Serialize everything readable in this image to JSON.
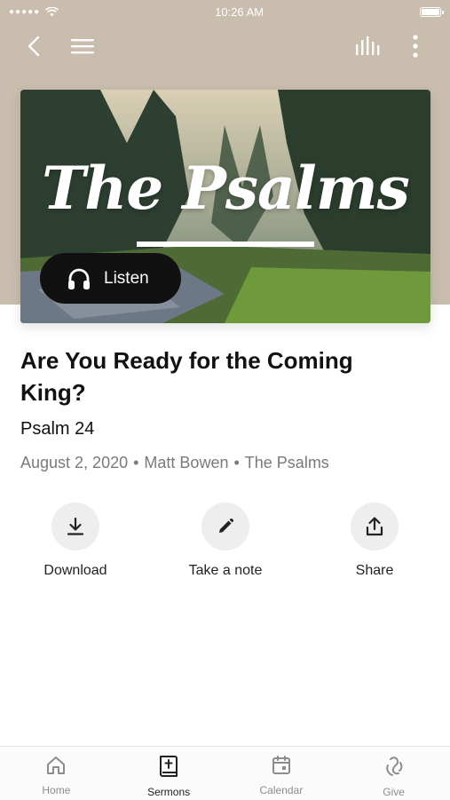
{
  "status_bar": {
    "time": "10:26 AM"
  },
  "nav": {
    "back": "back-icon",
    "menu": "menu-icon",
    "audio": "audio-bars-icon",
    "more": "more-vertical-icon"
  },
  "hero": {
    "series_title": "The Psalms",
    "listen_label": "Listen"
  },
  "sermon": {
    "title": "Are You Ready for the Coming King?",
    "passage": "Psalm 24",
    "date": "August 2, 2020",
    "speaker": "Matt Bowen",
    "series": "The Psalms",
    "separator": "•"
  },
  "actions": [
    {
      "label": "Download",
      "icon": "download-icon"
    },
    {
      "label": "Take a note",
      "icon": "pencil-icon"
    },
    {
      "label": "Share",
      "icon": "share-icon"
    }
  ],
  "tabs": [
    {
      "label": "Home",
      "icon": "home-icon",
      "active": false
    },
    {
      "label": "Sermons",
      "icon": "bible-icon",
      "active": true
    },
    {
      "label": "Calendar",
      "icon": "calendar-icon",
      "active": false
    },
    {
      "label": "Give",
      "icon": "give-icon",
      "active": false
    }
  ],
  "colors": {
    "header_bg": "#c9bdae",
    "listen_bg": "#111111",
    "action_circle": "#eeeeee",
    "meta_text": "#7a7a7a"
  }
}
